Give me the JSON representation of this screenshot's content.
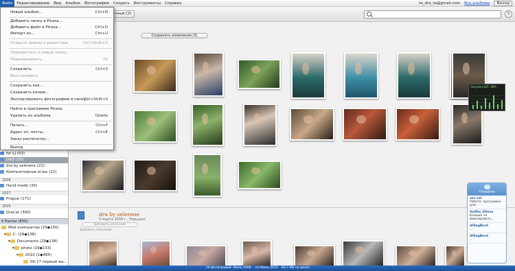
{
  "menubar": {
    "items": [
      "Файл",
      "Редактирование",
      "Вид",
      "Альбом",
      "Фотография",
      "Создать",
      "Инструменты",
      "Справка"
    ],
    "account": "ta_dra_ta@gmail.com",
    "all_albums": "Все альбомы",
    "logout": "Выход"
  },
  "toolbar": {
    "gift_cd": "Подарочный CD"
  },
  "file_menu": {
    "items": [
      {
        "label": "Новый альбом...",
        "shortcut": "Ctrl+N",
        "disabled": false
      },
      {
        "label": "Добавить папку в Picasa...",
        "shortcut": "",
        "disabled": false
      },
      {
        "label": "Добавить файл в Picasa...",
        "shortcut": "Ctrl+O",
        "disabled": false
      },
      {
        "label": "Импорт из...",
        "shortcut": "Ctrl+U",
        "disabled": false
      },
      {
        "label": "Открыть файлы в редакторе",
        "shortcut": "Ctrl+Shift+O",
        "disabled": true
      },
      {
        "label": "Переместить в новую папку...",
        "shortcut": "",
        "disabled": true
      },
      {
        "label": "Переименовать...",
        "shortcut": "F2",
        "disabled": true
      },
      {
        "label": "Сохранить",
        "shortcut": "Ctrl+S",
        "disabled": false
      },
      {
        "label": "Восстановить",
        "shortcut": "",
        "disabled": true
      },
      {
        "label": "Сохранить как...",
        "shortcut": "",
        "disabled": false
      },
      {
        "label": "Сохранить копию...",
        "shortcut": "",
        "disabled": false
      },
      {
        "label": "Экспортировать фотографию в папку...",
        "shortcut": "Ctrl+Shift+S",
        "disabled": false
      },
      {
        "label": "Найти в программе Picasa",
        "shortcut": "",
        "disabled": false
      },
      {
        "label": "Удалить из альбома",
        "shortcut": "Delete",
        "disabled": false
      },
      {
        "label": "Печать...",
        "shortcut": "Ctrl+P",
        "disabled": false
      },
      {
        "label": "Адрес эл. почты...",
        "shortcut": "Ctrl+E",
        "disabled": false
      },
      {
        "label": "Заказ распечаток...",
        "shortcut": "",
        "disabled": false
      },
      {
        "label": "Выход",
        "shortcut": "",
        "disabled": false
      }
    ]
  },
  "left_panel": {
    "rows": [
      {
        "label": "for LJ (53)",
        "kind": "album",
        "selected": false
      },
      {
        "label": "D&D (20)",
        "kind": "album",
        "selected": true
      },
      {
        "label": "dra by selerene (22)",
        "kind": "album",
        "selected": false
      },
      {
        "label": "Компьютерные игры (22)",
        "kind": "album",
        "selected": false
      }
    ],
    "year_2008": "2008",
    "hand_made": "Hand-made (39)",
    "year_2007": "2007",
    "prague": "Prague (171)",
    "year_2005": "2005",
    "dracat": "DraCat (300)",
    "folders_section": "Папки (656)",
    "my_computer": "Мой компьютер (29◆156)",
    "drive_c": "C: (29◆138)",
    "documents": "Documents (29◆138)",
    "photo": "photo (19◆133)",
    "year_2010": "2010 (1◆485)",
    "first_folder": "06-17 первый вы..."
  },
  "main": {
    "save_changes": "Сохранить изменения (3)",
    "album_title": "dra by selerene",
    "album_date": "5 марта 2009 г., Норцыно",
    "add_description": "Добавить описание",
    "add_caption": "Добавить описание"
  },
  "netmon": {
    "title": "Загрузка ЦП: 38%"
  },
  "timeline": {
    "title": "Timeline",
    "tweets": [
      {
        "user": "ser-cat",
        "text": "Работа: программа для..."
      },
      {
        "user": "Vulfila_Ulfson",
        "text": "Больше не фиксировать..."
      },
      {
        "user": "dOlegBord",
        "text": "..."
      },
      {
        "user": "dOlegBord",
        "text": "..."
      }
    ]
  },
  "statusbar": {
    "count": "20 фотографий",
    "date1": "Июль 2008",
    "date2": "по Июнь 2010",
    "size": "66,7 МБ на диске"
  },
  "colors": {
    "accent": "#1f5fb3",
    "album_title": "#c2520d",
    "statusbar": "#2b6bbf"
  }
}
